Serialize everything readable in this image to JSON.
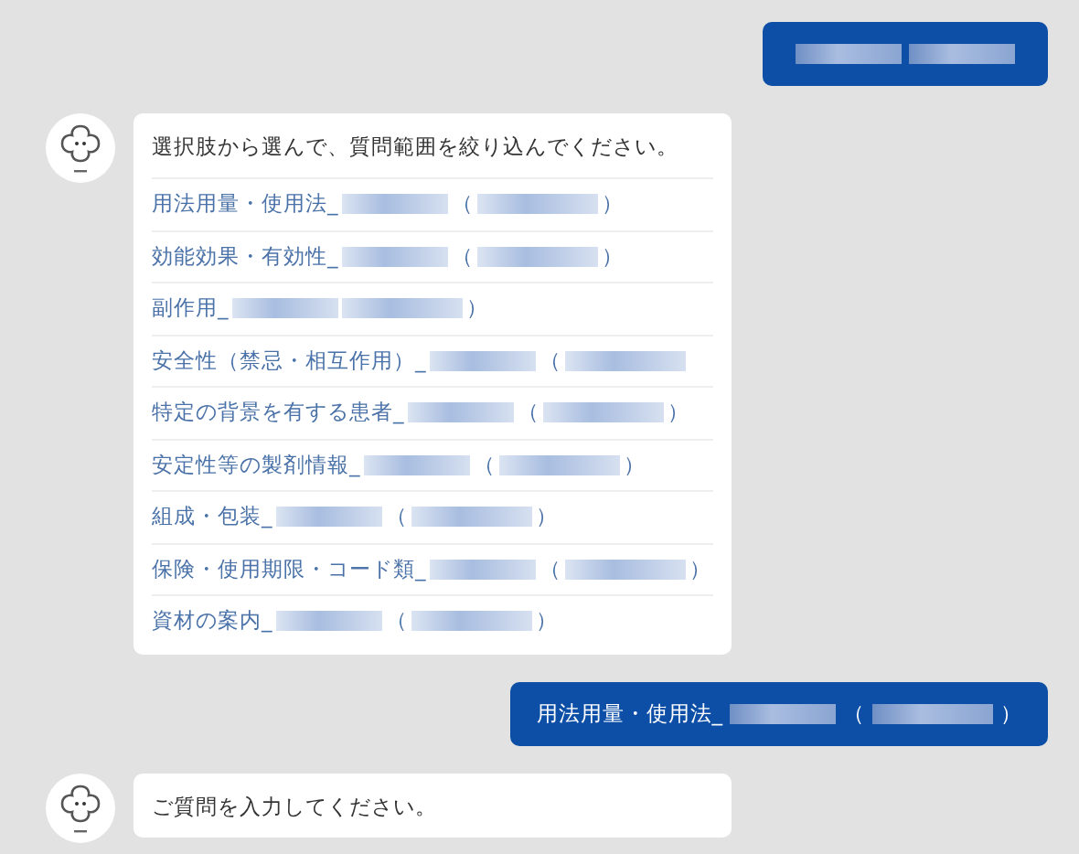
{
  "messages": [
    {
      "kind": "user",
      "parts": [
        {
          "kind": "blur"
        },
        {
          "kind": "blur"
        }
      ]
    },
    {
      "kind": "bot",
      "text": "選択肢から選んで、質問範囲を絞り込んでください。",
      "options": [
        {
          "parts": [
            {
              "kind": "text",
              "text": "用法用量・使用法_"
            },
            {
              "kind": "blur"
            },
            {
              "kind": "text",
              "text": "（"
            },
            {
              "kind": "blur"
            },
            {
              "kind": "text",
              "text": "）"
            }
          ]
        },
        {
          "parts": [
            {
              "kind": "text",
              "text": "効能効果・有効性_"
            },
            {
              "kind": "blur"
            },
            {
              "kind": "text",
              "text": "（"
            },
            {
              "kind": "blur"
            },
            {
              "kind": "text",
              "text": "）"
            }
          ]
        },
        {
          "parts": [
            {
              "kind": "text",
              "text": "副作用_"
            },
            {
              "kind": "blur"
            },
            {
              "kind": "blur"
            },
            {
              "kind": "text",
              "text": "）"
            }
          ]
        },
        {
          "parts": [
            {
              "kind": "text",
              "text": "安全性（禁忌・相互作用）_"
            },
            {
              "kind": "blur"
            },
            {
              "kind": "text",
              "text": "（"
            },
            {
              "kind": "blur"
            }
          ]
        },
        {
          "parts": [
            {
              "kind": "text",
              "text": "特定の背景を有する患者_"
            },
            {
              "kind": "blur"
            },
            {
              "kind": "text",
              "text": "（"
            },
            {
              "kind": "blur"
            },
            {
              "kind": "text",
              "text": "）"
            }
          ]
        },
        {
          "parts": [
            {
              "kind": "text",
              "text": "安定性等の製剤情報_"
            },
            {
              "kind": "blur"
            },
            {
              "kind": "text",
              "text": "（"
            },
            {
              "kind": "blur"
            },
            {
              "kind": "text",
              "text": "）"
            }
          ]
        },
        {
          "parts": [
            {
              "kind": "text",
              "text": "組成・包装_"
            },
            {
              "kind": "blur"
            },
            {
              "kind": "text",
              "text": "（"
            },
            {
              "kind": "blur"
            },
            {
              "kind": "text",
              "text": "）"
            }
          ]
        },
        {
          "parts": [
            {
              "kind": "text",
              "text": "保険・使用期限・コード類_"
            },
            {
              "kind": "blur"
            },
            {
              "kind": "text",
              "text": "（"
            },
            {
              "kind": "blur"
            },
            {
              "kind": "text",
              "text": "）"
            }
          ]
        },
        {
          "parts": [
            {
              "kind": "text",
              "text": "資材の案内_"
            },
            {
              "kind": "blur"
            },
            {
              "kind": "text",
              "text": "（"
            },
            {
              "kind": "blur"
            },
            {
              "kind": "text",
              "text": "）"
            }
          ]
        }
      ]
    },
    {
      "kind": "user",
      "parts": [
        {
          "kind": "text",
          "text": "用法用量・使用法_"
        },
        {
          "kind": "blur"
        },
        {
          "kind": "text",
          "text": "（"
        },
        {
          "kind": "blur"
        },
        {
          "kind": "text",
          "text": "）"
        }
      ]
    },
    {
      "kind": "bot",
      "text": "ご質問を入力してください。"
    }
  ]
}
